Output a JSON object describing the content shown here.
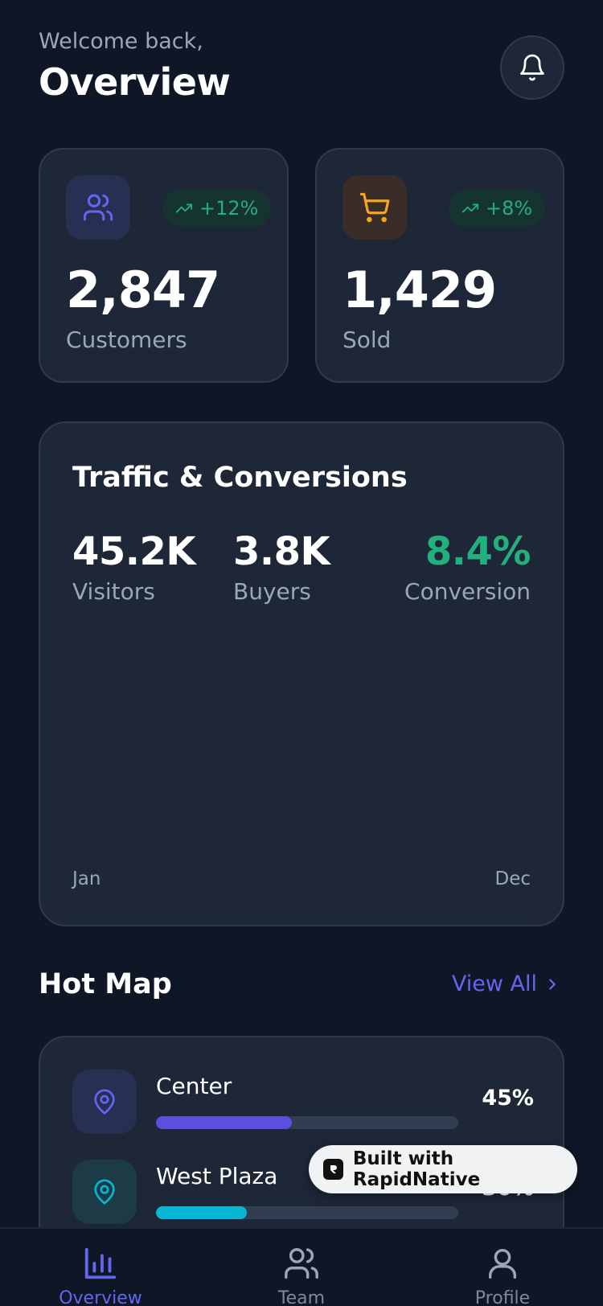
{
  "header": {
    "welcome": "Welcome back,",
    "title": "Overview"
  },
  "stats": [
    {
      "icon": "users-icon",
      "badge": "+12%",
      "value": "2,847",
      "label": "Customers",
      "icon_color": "#6366f1",
      "icon_bg": "#272f52"
    },
    {
      "icon": "cart-icon",
      "badge": "+8%",
      "value": "1,429",
      "label": "Sold",
      "icon_color": "#f5a524",
      "icon_bg": "#3a2c27"
    }
  ],
  "traffic": {
    "title": "Traffic & Conversions",
    "metrics": [
      {
        "value": "45.2K",
        "label": "Visitors"
      },
      {
        "value": "3.8K",
        "label": "Buyers"
      },
      {
        "value": "8.4%",
        "label": "Conversion",
        "color": "#22b07d"
      }
    ],
    "axis_start": "Jan",
    "axis_end": "Dec"
  },
  "hot_map": {
    "title": "Hot Map",
    "view_all": "View All",
    "items": [
      {
        "name": "Center",
        "percent_label": "45%",
        "percent": 45,
        "color": "#5b4fe0",
        "icon_bg": "#272f52",
        "icon_color": "#6366f1"
      },
      {
        "name": "West Plaza",
        "percent_label": "30%",
        "percent": 30,
        "color": "#06b6d4",
        "icon_bg": "#1d3a47",
        "icon_color": "#06b6d4"
      }
    ]
  },
  "badge": {
    "text": "Built with RapidNative"
  },
  "tabs": [
    {
      "label": "Overview",
      "icon": "bar-chart-icon",
      "active": true
    },
    {
      "label": "Team",
      "icon": "team-icon",
      "active": false
    },
    {
      "label": "Profile",
      "icon": "profile-icon",
      "active": false
    }
  ],
  "colors": {
    "accent": "#6366f1",
    "positive": "#22b07d",
    "muted": "#9aa6ba"
  }
}
